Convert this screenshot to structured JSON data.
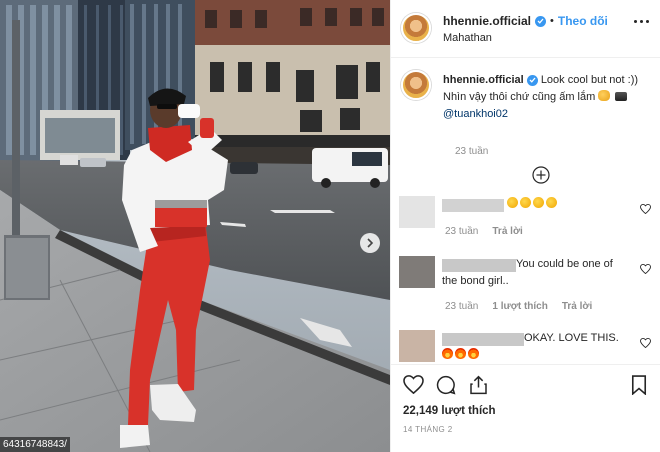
{
  "post": {
    "username": "hhennie.official",
    "separator": "•",
    "follow_label": "Theo dõi",
    "location": "Mahathan",
    "photo_id": "64316748843/"
  },
  "caption": {
    "username": "hhennie.official",
    "text_line1": "Look cool but not :))",
    "text_line2": "Nhìn vậy thôi chứ cũng ấm lắm",
    "mention": "@tuankhoi02",
    "time": "23 tuần"
  },
  "comments": [
    {
      "text": "",
      "emojis": [
        "emo-y",
        "emo-y",
        "emo-y",
        "emo-y"
      ],
      "time": "23 tuần",
      "likes": "",
      "reply": "Trả lời"
    },
    {
      "text_prefix": "You could be one of",
      "text_line2": "the bond girl..",
      "time": "23 tuần",
      "likes": "1 lượt thích",
      "reply": "Trả lời"
    },
    {
      "text": "OKAY. LOVE THIS.",
      "emojis": [
        "emo-fire",
        "emo-fire",
        "emo-fire"
      ]
    }
  ],
  "actions": {
    "likes": "22,149 lượt thích",
    "date": "14 THÁNG 2"
  },
  "colors": {
    "accent": "#3897f0",
    "text": "#262626",
    "muted": "#8e8e8e",
    "jacket_red": "#d8322a"
  }
}
